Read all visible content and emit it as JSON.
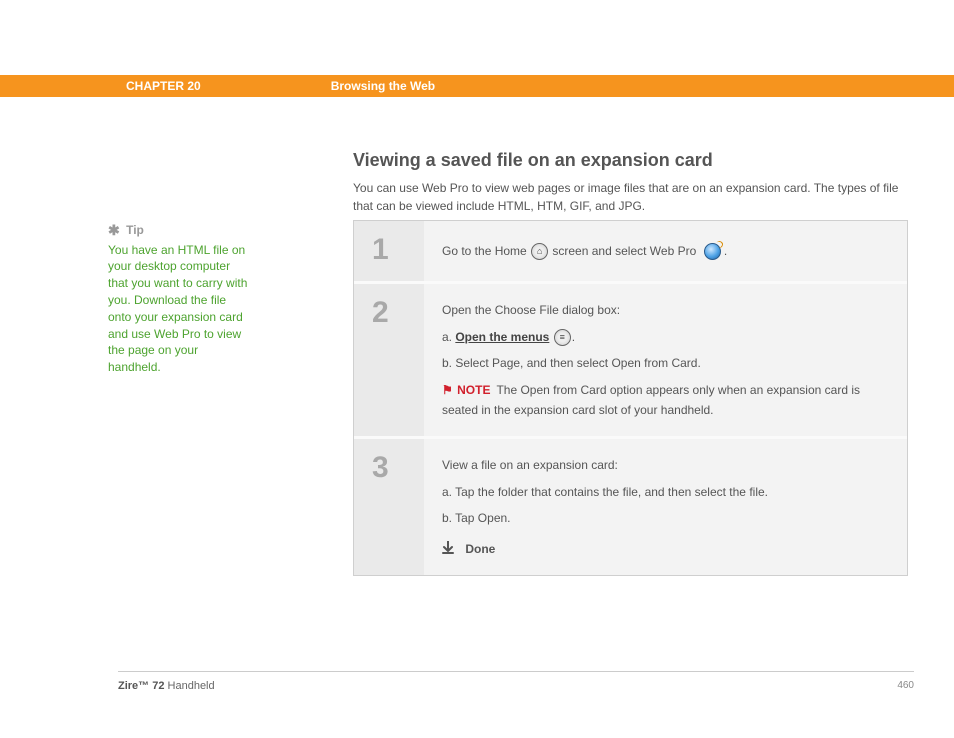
{
  "header": {
    "chapter": "CHAPTER 20",
    "title": "Browsing the Web"
  },
  "section": {
    "heading": "Viewing a saved file on an expansion card",
    "intro": "You can use Web Pro to view web pages or image files that are on an expansion card. The types of file that can be viewed include HTML, HTM, GIF, and JPG."
  },
  "tip": {
    "label": "Tip",
    "body": "You have an HTML file on your desktop computer that you want to carry with you. Download the file onto your expansion card and use Web Pro to view the page on your handheld."
  },
  "steps": {
    "s1": {
      "num": "1",
      "pre": "Go to the Home ",
      "post": " screen and select Web Pro  ",
      "end": "."
    },
    "s2": {
      "num": "2",
      "title": "Open the Choose File dialog box:",
      "a_pre": "a.  ",
      "a_link": "Open the menus",
      "a_post": " ",
      "a_end": ".",
      "b": "b.  Select Page, and then select Open from Card.",
      "note_label": "NOTE",
      "note": "The Open from Card option appears only when an expansion card is seated in the expansion card slot of your handheld."
    },
    "s3": {
      "num": "3",
      "title": "View a file on an expansion card:",
      "a": "a.  Tap the folder that contains the file, and then select the file.",
      "b": "b.  Tap Open.",
      "done": "Done"
    }
  },
  "footer": {
    "product_bold": "Zire™ 72",
    "product_rest": " Handheld",
    "page": "460"
  }
}
